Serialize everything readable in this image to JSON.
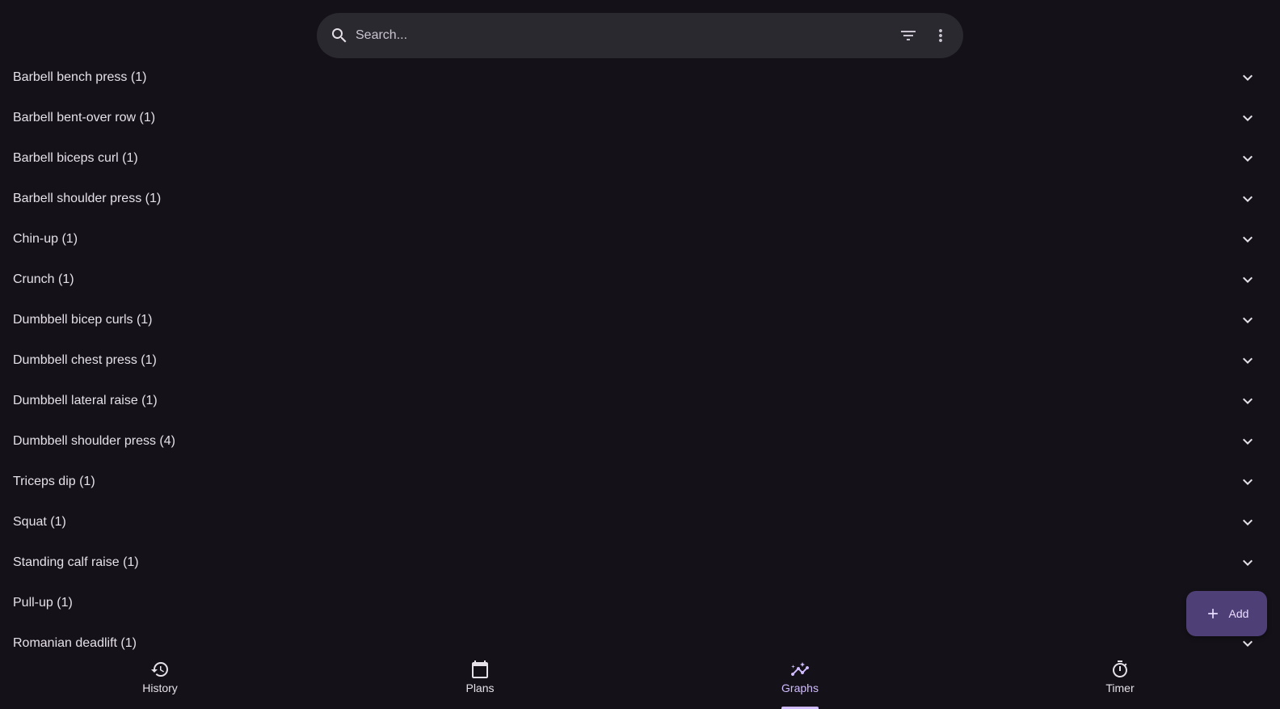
{
  "search": {
    "placeholder": "Search...",
    "value": ""
  },
  "icons": {
    "search": "search-icon",
    "filter": "filter-icon",
    "more": "more-vert-icon",
    "expand": "chevron-down-icon",
    "add": "plus-icon"
  },
  "exercises": [
    {
      "label": "Barbell bench press (1)"
    },
    {
      "label": "Barbell bent-over row (1)"
    },
    {
      "label": "Barbell biceps curl (1)"
    },
    {
      "label": "Barbell shoulder press (1)"
    },
    {
      "label": "Chin-up (1)"
    },
    {
      "label": "Crunch (1)"
    },
    {
      "label": "Dumbbell bicep curls (1)"
    },
    {
      "label": "Dumbbell chest press (1)"
    },
    {
      "label": "Dumbbell lateral raise (1)"
    },
    {
      "label": "Dumbbell shoulder press (4)"
    },
    {
      "label": "Triceps dip (1)"
    },
    {
      "label": "Squat (1)"
    },
    {
      "label": "Standing calf raise (1)"
    },
    {
      "label": "Pull-up (1)"
    },
    {
      "label": "Romanian deadlift (1)"
    }
  ],
  "fab": {
    "label": "Add"
  },
  "nav": {
    "items": [
      {
        "label": "History",
        "icon": "history-icon"
      },
      {
        "label": "Plans",
        "icon": "calendar-icon"
      },
      {
        "label": "Graphs",
        "icon": "graph-icon"
      },
      {
        "label": "Timer",
        "icon": "timer-icon"
      }
    ],
    "active": "Graphs"
  },
  "colors": {
    "background": "#141218",
    "surface": "#2b2930",
    "accent": "#d0bcff",
    "fab": "#4f3f77",
    "text": "#e6e0e9"
  }
}
